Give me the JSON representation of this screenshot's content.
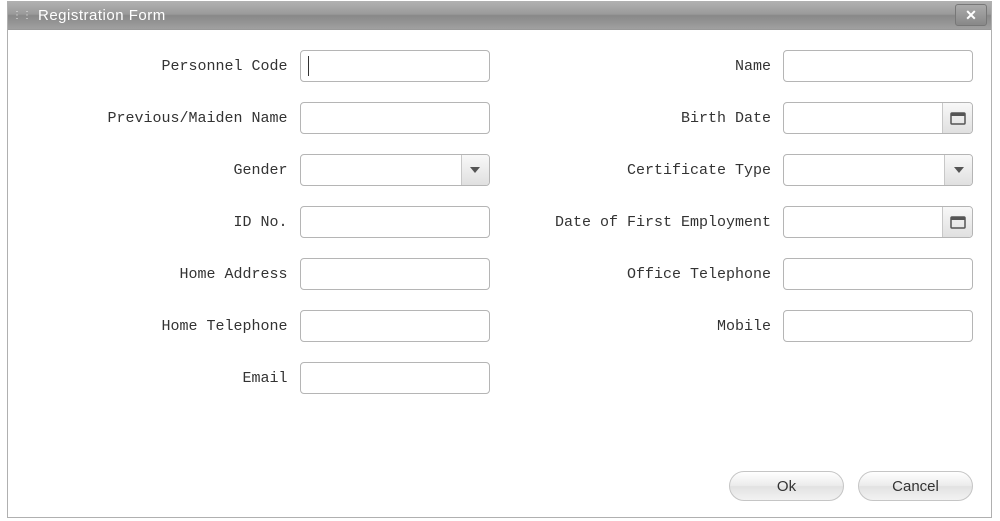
{
  "dialog": {
    "title": "Registration Form"
  },
  "fields": {
    "personnel_code": {
      "label": "Personnel Code",
      "value": ""
    },
    "name": {
      "label": "Name",
      "value": ""
    },
    "previous_name": {
      "label": "Previous/Maiden Name",
      "value": ""
    },
    "birth_date": {
      "label": "Birth Date",
      "value": ""
    },
    "gender": {
      "label": "Gender",
      "value": ""
    },
    "certificate_type": {
      "label": "Certificate Type",
      "value": ""
    },
    "id_no": {
      "label": "ID No.",
      "value": ""
    },
    "date_first_employment": {
      "label": "Date of First Employment",
      "value": ""
    },
    "home_address": {
      "label": "Home Address",
      "value": ""
    },
    "office_telephone": {
      "label": "Office Telephone",
      "value": ""
    },
    "home_telephone": {
      "label": "Home Telephone",
      "value": ""
    },
    "mobile": {
      "label": "Mobile",
      "value": ""
    },
    "email": {
      "label": "Email",
      "value": ""
    }
  },
  "buttons": {
    "ok": "Ok",
    "cancel": "Cancel"
  }
}
